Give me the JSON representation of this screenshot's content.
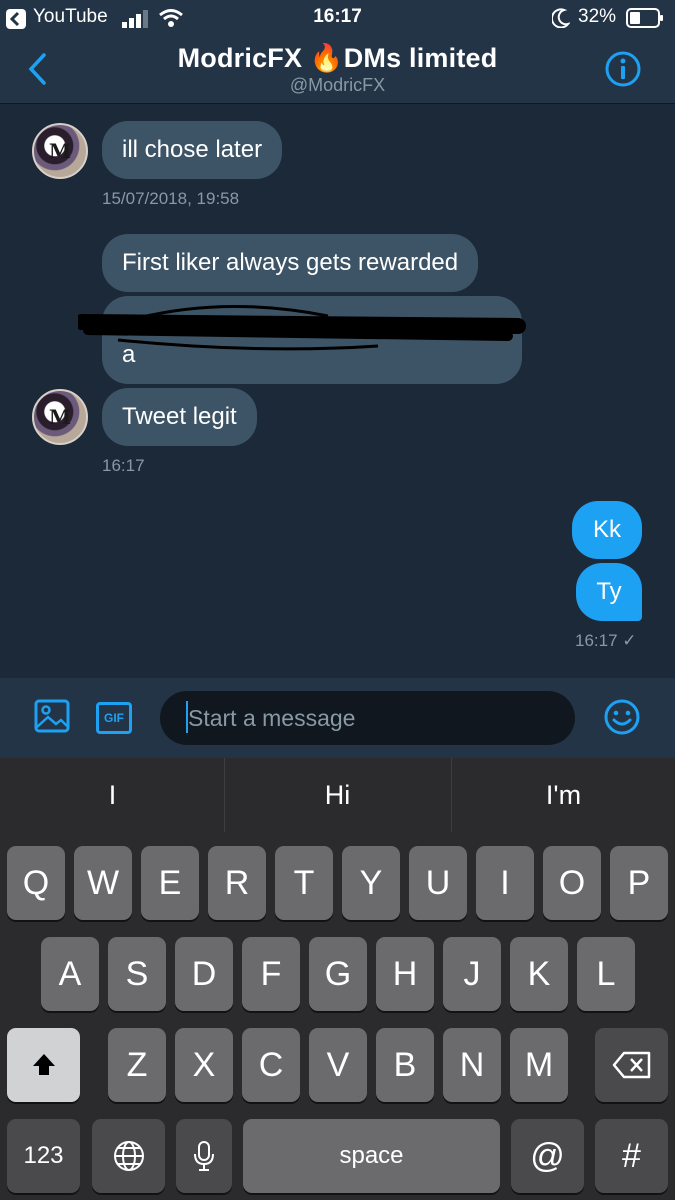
{
  "status_bar": {
    "back_app": "YouTube",
    "time": "16:17",
    "battery": "32%"
  },
  "header": {
    "title": "ModricFX 🔥DMs limited",
    "handle": "@ModricFX"
  },
  "avatar_letter": "M",
  "messages": [
    {
      "text": "ill chose later",
      "direction": "in"
    },
    {
      "text": "First liker always gets rewarded",
      "direction": "in"
    },
    {
      "text": "a",
      "direction": "in",
      "note_redacted_first_line": true
    },
    {
      "text": "Tweet legit",
      "direction": "in"
    },
    {
      "text": "Kk",
      "direction": "out"
    },
    {
      "text": "Ty",
      "direction": "out"
    }
  ],
  "timestamps": {
    "first": "15/07/2018, 19:58",
    "second": "16:17",
    "sent": "16:17 ✓"
  },
  "composer": {
    "placeholder": "Start a message",
    "gif_label": "GIF"
  },
  "keyboard": {
    "suggestions": [
      "I",
      "Hi",
      "I'm"
    ],
    "row1": [
      "Q",
      "W",
      "E",
      "R",
      "T",
      "Y",
      "U",
      "I",
      "O",
      "P"
    ],
    "row2": [
      "A",
      "S",
      "D",
      "F",
      "G",
      "H",
      "J",
      "K",
      "L"
    ],
    "row3": [
      "Z",
      "X",
      "C",
      "V",
      "B",
      "N",
      "M"
    ],
    "num_key": "123",
    "space_key": "space",
    "at_key": "@",
    "hash_key": "#"
  },
  "colors": {
    "background": "#1c2938",
    "bar": "#243447",
    "accent": "#1da1f2",
    "incoming_bubble": "#3d5466"
  }
}
